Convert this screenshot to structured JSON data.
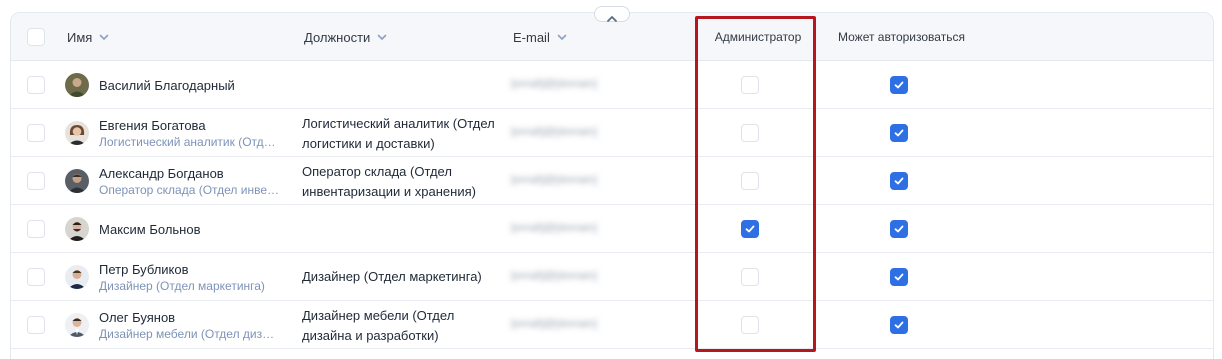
{
  "header": {
    "col_name": "Имя",
    "col_positions": "Должности",
    "col_email": "E-mail",
    "col_admin": "Администратор",
    "col_can_login": "Может авторизоваться"
  },
  "rows": [
    {
      "name": "Василий Благодарный",
      "subtitle": "",
      "position": "",
      "email": "[email]@[domain]",
      "admin": false,
      "can_login": true
    },
    {
      "name": "Евгения Богатова",
      "subtitle": "Логистический аналитик (Отд…",
      "position": "Логистический аналитик (Отдел логистики и доставки)",
      "email": "[email]@[domain]",
      "admin": false,
      "can_login": true
    },
    {
      "name": "Александр Богданов",
      "subtitle": "Оператор склада (Отдел инве…",
      "position": "Оператор склада (Отдел инвентаризации и хранения)",
      "email": "[email]@[domain]",
      "admin": false,
      "can_login": true
    },
    {
      "name": "Максим Больнов",
      "subtitle": "",
      "position": "",
      "email": "[email]@[domain]",
      "admin": true,
      "can_login": true
    },
    {
      "name": "Петр Бубликов",
      "subtitle": "Дизайнер (Отдел маркетинга)",
      "position": "Дизайнер (Отдел маркетинга)",
      "email": "[email]@[domain]",
      "admin": false,
      "can_login": true
    },
    {
      "name": "Олег Буянов",
      "subtitle": "Дизайнер мебели (Отдел диз…",
      "position": "Дизайнер мебели (Отдел дизайна и разработки)",
      "email": "[email]@[domain]",
      "admin": false,
      "can_login": true
    }
  ],
  "colors": {
    "accent": "#2f6fe4",
    "highlight": "#b5171d",
    "subtitle": "#7d93b8",
    "header_bg": "#f5f7fa"
  },
  "icons": {
    "sort": "chevron-down-icon",
    "collapse": "chevron-up-icon",
    "check": "check-icon"
  }
}
